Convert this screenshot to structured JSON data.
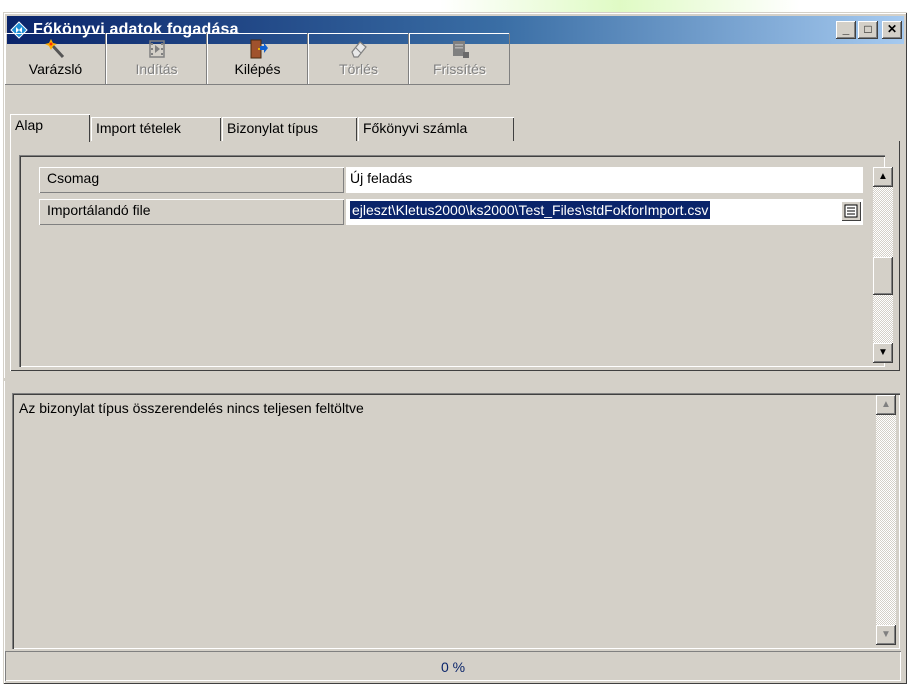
{
  "window": {
    "title": "Főkönyvi adatok fogadása",
    "controls": {
      "minimize": "_",
      "maximize": "□",
      "close": "✕"
    }
  },
  "toolbar": {
    "items": [
      {
        "label": "Varázsló",
        "icon": "wizard-wand-icon",
        "enabled": true
      },
      {
        "label": "Indítás",
        "icon": "play-film-icon",
        "enabled": false
      },
      {
        "label": "Kilépés",
        "icon": "exit-door-icon",
        "enabled": true
      },
      {
        "label": "Törlés",
        "icon": "eraser-icon",
        "enabled": false
      },
      {
        "label": "Frissítés",
        "icon": "refresh-icon",
        "enabled": false
      }
    ]
  },
  "tabs": [
    {
      "label": "Alap",
      "active": true
    },
    {
      "label": "Import tételek",
      "active": false
    },
    {
      "label": "Bizonylat típus",
      "active": false
    },
    {
      "label": "Főkönyvi számla",
      "active": false
    }
  ],
  "properties": [
    {
      "label": "Csomag",
      "value": "Új feladás"
    },
    {
      "label": "Importálandó file",
      "value": "ejleszt\\Kletus2000\\ks2000\\Test_Files\\stdFokforImport.csv"
    }
  ],
  "message": "Az bizonylat típus összerendelés nincs teljesen feltöltve",
  "status": {
    "progress_text": "0 %",
    "progress": 0
  },
  "colors": {
    "title_start": "#0a246a",
    "title_end": "#a6caf0",
    "face": "#d4d0c8",
    "selection": "#0a246a"
  }
}
